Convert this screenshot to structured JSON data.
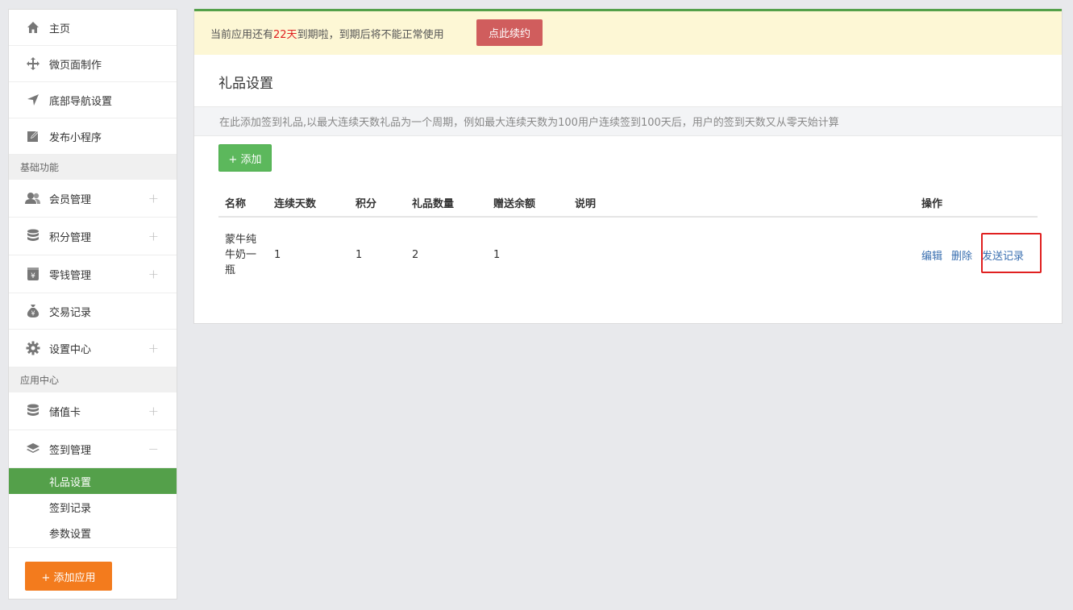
{
  "sidebar": {
    "top_items": [
      {
        "label": "主页",
        "icon": "home-icon"
      },
      {
        "label": "微页面制作",
        "icon": "move-icon"
      },
      {
        "label": "底部导航设置",
        "icon": "navigation-arrow-icon"
      },
      {
        "label": "发布小程序",
        "icon": "edit-icon"
      }
    ],
    "section_basic": "基础功能",
    "basic_items": [
      {
        "label": "会员管理",
        "icon": "users-icon",
        "expand": "+"
      },
      {
        "label": "积分管理",
        "icon": "database-icon",
        "expand": "+"
      },
      {
        "label": "零钱管理",
        "icon": "wallet-icon",
        "expand": "+"
      },
      {
        "label": "交易记录",
        "icon": "money-bag-icon"
      },
      {
        "label": "设置中心",
        "icon": "gear-icon",
        "expand": "+"
      }
    ],
    "section_apps": "应用中心",
    "app_items": [
      {
        "label": "储值卡",
        "icon": "database-icon",
        "expand": "+"
      },
      {
        "label": "签到管理",
        "icon": "layers-icon",
        "expand": "−"
      }
    ],
    "sub_items": [
      {
        "label": "礼品设置",
        "active": true
      },
      {
        "label": "签到记录"
      },
      {
        "label": "参数设置"
      }
    ],
    "add_app_label": "+ 添加应用"
  },
  "notice": {
    "prefix": "当前应用还有",
    "days": "22天",
    "suffix": "到期啦，到期后将不能正常使用",
    "renew_label": "点此续约"
  },
  "page": {
    "title": "礼品设置",
    "info": "在此添加签到礼品,以最大连续天数礼品为一个周期，例如最大连续天数为100用户连续签到100天后，用户的签到天数又从零天始计算",
    "add_label": "+ 添加"
  },
  "table": {
    "headers": [
      "名称",
      "连续天数",
      "积分",
      "礼品数量",
      "赠送余额",
      "说明",
      "操作"
    ],
    "rows": [
      {
        "name": "蒙牛纯牛奶一瓶",
        "days": "1",
        "points": "1",
        "quantity": "2",
        "balance": "1",
        "note": "",
        "actions": [
          "编辑",
          "删除",
          "发送记录"
        ]
      }
    ]
  },
  "colors": {
    "accent_green": "#54a04a",
    "add_button": "#5cb85c",
    "renew_button": "#d05d5d",
    "orange_button": "#f37b1d",
    "link": "#3a6fb0",
    "highlight": "#e02020"
  }
}
